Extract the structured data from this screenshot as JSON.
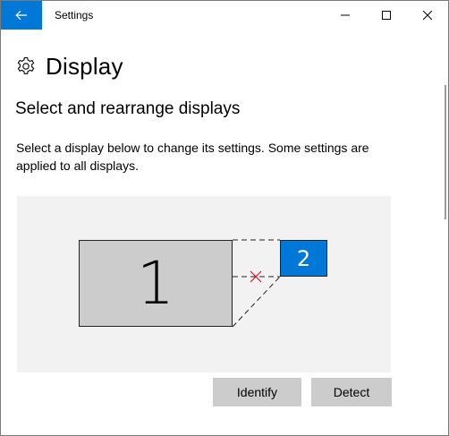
{
  "window": {
    "title": "Settings",
    "controls": {
      "minimize": "minimize-icon",
      "maximize": "maximize-icon",
      "close": "close-icon"
    },
    "back_icon": "back-arrow-icon",
    "accent_color": "#0078d7"
  },
  "page": {
    "icon": "gear-icon",
    "title": "Display"
  },
  "section": {
    "title": "Select and rearrange displays",
    "description": "Select a display below to change its settings. Some settings are applied to all displays."
  },
  "arrangement": {
    "displays": [
      {
        "label": "1",
        "selected": false
      },
      {
        "label": "2",
        "selected": true
      }
    ],
    "snap_indicator": "x-mark-icon"
  },
  "buttons": {
    "identify": "Identify",
    "detect": "Detect"
  }
}
